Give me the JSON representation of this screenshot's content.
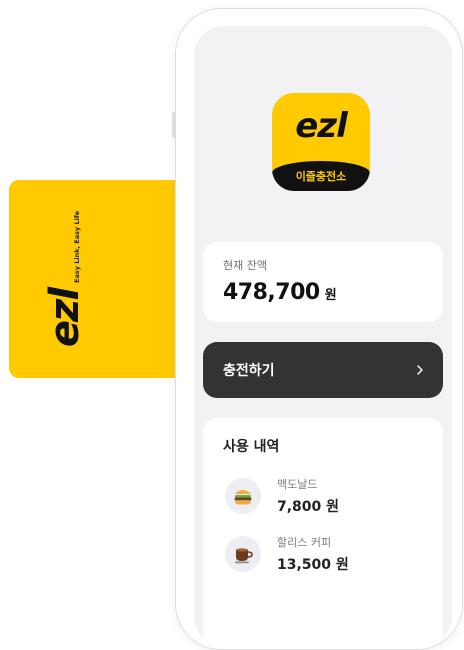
{
  "card": {
    "logo": "ezl",
    "slogan": "Easy Link, Easy Life",
    "color": "#FFCB00"
  },
  "app_icon": {
    "logo": "ezl",
    "band_text": "이즐충전소"
  },
  "balance": {
    "label": "현재 잔액",
    "amount": "478,700",
    "unit": "원"
  },
  "charge_button": {
    "label": "충전하기",
    "icon": "chevron-right-icon",
    "color": "#333333"
  },
  "history": {
    "title": "사용 내역",
    "items": [
      {
        "name": "맥도날드",
        "amount": "7,800 원",
        "icon": "burger-icon"
      },
      {
        "name": "할리스 커피",
        "amount": "13,500 원",
        "icon": "coffee-cup-icon"
      }
    ]
  }
}
